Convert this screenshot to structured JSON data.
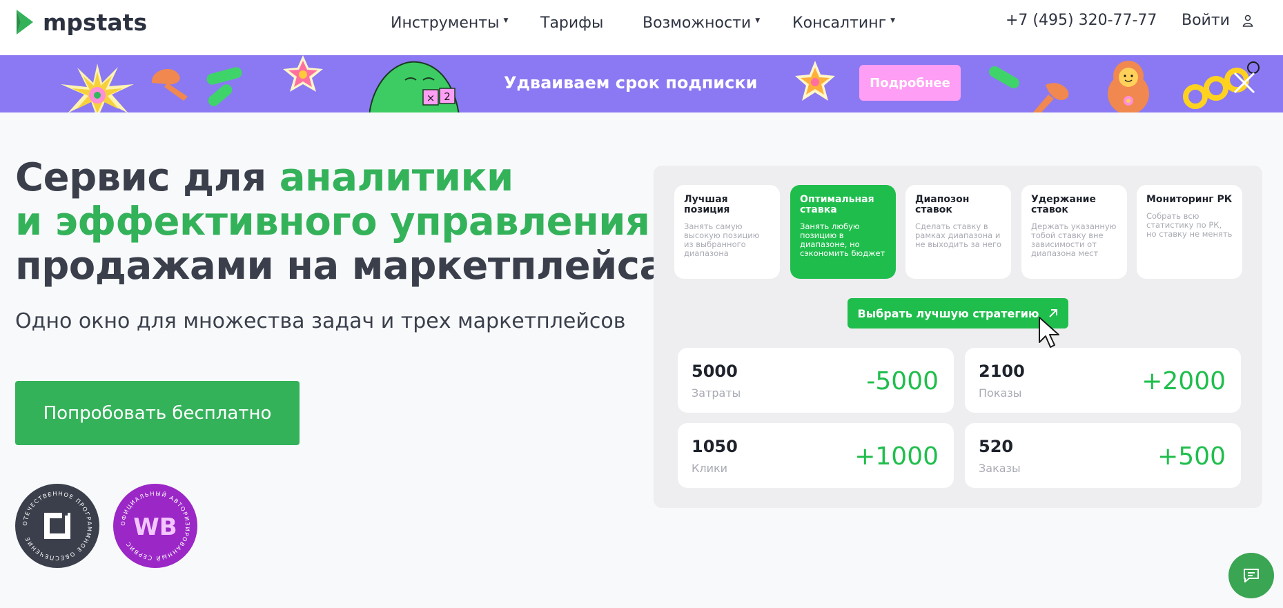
{
  "header": {
    "logo_text": "mpstats",
    "nav": [
      {
        "label": "Инструменты",
        "has_dropdown": true
      },
      {
        "label": "Тарифы",
        "has_dropdown": false
      },
      {
        "label": "Возможности",
        "has_dropdown": true
      },
      {
        "label": "Консалтинг",
        "has_dropdown": true
      }
    ],
    "phone": "+7 (495) 320-77-77",
    "login": "Войти"
  },
  "banner": {
    "text": "Удваиваем срок подписки",
    "button": "Подробнее",
    "x2_a": "×",
    "x2_b": "2",
    "bg_color": "#8a79f2"
  },
  "hero": {
    "title_part1": "Сервис для ",
    "title_accent": "аналитики и эффективного управления",
    "title_part2": "продажами на маркетплейсах",
    "subtitle": "Одно окно для множества задач и трех маркетплейсов",
    "cta": "Попробовать бесплатно",
    "accent_color": "#34b25a"
  },
  "badges": [
    {
      "ring_text": "ОТЕЧЕСТВЕННОЕ ПРОГРАММНОЕ ОБЕСПЕЧЕНИЕ",
      "icon": "software-registry-icon"
    },
    {
      "ring_text": "ОФИЦИАЛЬНЫЙ АВТОРИЗИРОВАННЫЙ СЕРВИС",
      "center": "WB"
    }
  ],
  "dashboard": {
    "strategies": [
      {
        "title": "Лучшая позиция",
        "desc": "Занять самую высокую позицию из выбранного диапазона",
        "active": false
      },
      {
        "title": "Оптимальная ставка",
        "desc": "Занять любую позицию в диапазоне, но сэкономить бюджет",
        "active": true
      },
      {
        "title": "Диапозон ставок",
        "desc": "Сделать ставку в рамках диапазона и не выходить за него",
        "active": false
      },
      {
        "title": "Удержание ставок",
        "desc": "Держать указанную тобой ставку вне зависимости от диапазона мест",
        "active": false
      },
      {
        "title": "Мониторинг РК",
        "desc": "Собрать всю статистику по РК, но ставку не менять",
        "active": false
      }
    ],
    "choose_button": "Выбрать лучшую стратегию",
    "metrics": [
      {
        "value": "5000",
        "label": "Затраты",
        "delta": "-5000"
      },
      {
        "value": "2100",
        "label": "Показы",
        "delta": "+2000"
      },
      {
        "value": "1050",
        "label": "Клики",
        "delta": "+1000"
      },
      {
        "value": "520",
        "label": "Заказы",
        "delta": "+500"
      }
    ]
  },
  "chat": {
    "icon": "chat-icon"
  }
}
